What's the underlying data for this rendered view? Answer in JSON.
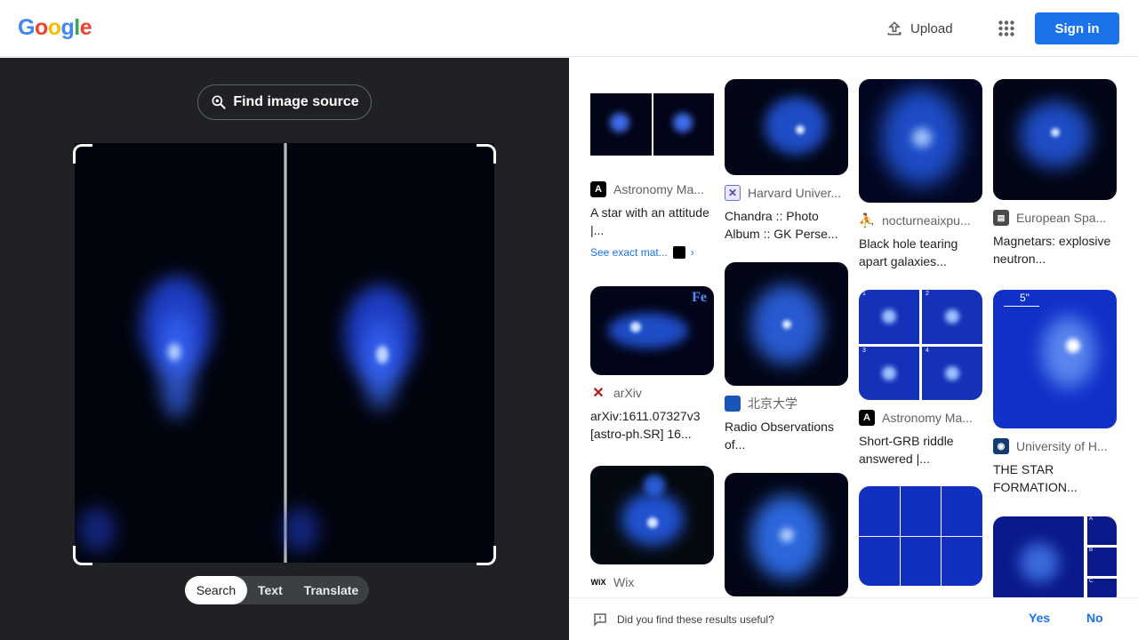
{
  "header": {
    "logo": [
      "G",
      "o",
      "o",
      "g",
      "l",
      "e"
    ],
    "upload_label": "Upload",
    "signin_label": "Sign in"
  },
  "left": {
    "find_source_label": "Find image source",
    "tabs": [
      "Search",
      "Text",
      "Translate"
    ],
    "active_tab": "Search"
  },
  "results": [
    {
      "source": "Astronomy Ma...",
      "title": "A star with an attitude |...",
      "exact_matches": "See exact mat..."
    },
    {
      "source": "Harvard Univer...",
      "title": "Chandra :: Photo Album :: GK Perse..."
    },
    {
      "source": "nocturneaixpu...",
      "title": "Black hole tearing apart galaxies..."
    },
    {
      "source": "European Spa...",
      "title": "Magnetars: explosive neutron..."
    },
    {
      "source": "arXiv",
      "title": "arXiv:1611.07327v3 [astro-ph.SR] 16..."
    },
    {
      "source": "北京大学",
      "title": "Radio Observations of..."
    },
    {
      "source": "Astronomy Ma...",
      "title": "Short-GRB riddle answered |..."
    },
    {
      "source": "University of H...",
      "title": "THE STAR FORMATION..."
    },
    {
      "source": "Wix"
    }
  ],
  "thumb_labels": {
    "fe": "Fe",
    "panel_nums": [
      "1",
      "2",
      "3",
      "4"
    ],
    "scale": "5\"",
    "abc": [
      "A",
      "B",
      "C"
    ]
  },
  "feedback": {
    "question": "Did you find these results useful?",
    "yes": "Yes",
    "no": "No"
  },
  "colors": {
    "accent": "#1a73e8",
    "left_bg": "#202124"
  }
}
